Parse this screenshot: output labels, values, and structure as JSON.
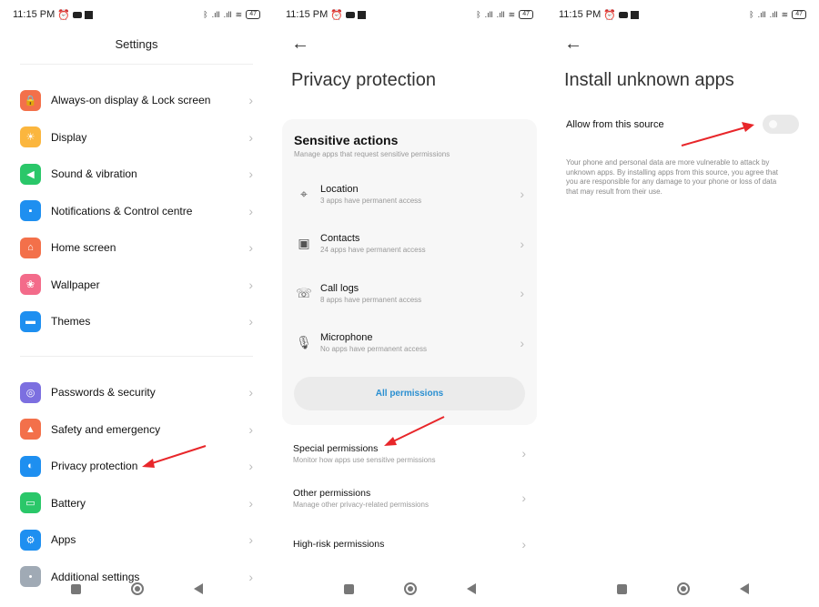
{
  "status_bar": {
    "time": "11:15 PM",
    "battery": "47"
  },
  "screen1": {
    "title": "Settings",
    "group1": [
      {
        "label": "Always-on display & Lock screen",
        "icon": "lock-icon",
        "color": "#f3704a",
        "glyph": "🔒"
      },
      {
        "label": "Display",
        "icon": "sun-icon",
        "color": "#fbb63e",
        "glyph": "☀"
      },
      {
        "label": "Sound & vibration",
        "icon": "speaker-icon",
        "color": "#2ac769",
        "glyph": "◀"
      },
      {
        "label": "Notifications & Control centre",
        "icon": "notification-icon",
        "color": "#1e8ff0",
        "glyph": "▪"
      },
      {
        "label": "Home screen",
        "icon": "home-icon",
        "color": "#f3704a",
        "glyph": "⌂"
      },
      {
        "label": "Wallpaper",
        "icon": "tulip-icon",
        "color": "#f36b8a",
        "glyph": "❀"
      },
      {
        "label": "Themes",
        "icon": "brush-icon",
        "color": "#1e8ff0",
        "glyph": "▬"
      }
    ],
    "group2": [
      {
        "label": "Passwords & security",
        "icon": "fingerprint-icon",
        "color": "#7c6fe0",
        "glyph": "◎"
      },
      {
        "label": "Safety and emergency",
        "icon": "siren-icon",
        "color": "#f3704a",
        "glyph": "▲"
      },
      {
        "label": "Privacy protection",
        "icon": "shield-icon",
        "color": "#1e8ff0",
        "glyph": "◐"
      },
      {
        "label": "Battery",
        "icon": "battery-icon",
        "color": "#2ac769",
        "glyph": "▭"
      },
      {
        "label": "Apps",
        "icon": "gear-icon",
        "color": "#1e8ff0",
        "glyph": "⚙"
      },
      {
        "label": "Additional settings",
        "icon": "more-icon",
        "color": "#a0aab5",
        "glyph": "•"
      }
    ]
  },
  "screen2": {
    "title": "Privacy protection",
    "card": {
      "title": "Sensitive actions",
      "subtitle": "Manage apps that request sensitive permissions",
      "items": [
        {
          "title": "Location",
          "sub": "3 apps have permanent access",
          "glyph": "⌖"
        },
        {
          "title": "Contacts",
          "sub": "24 apps have permanent access",
          "glyph": "▣"
        },
        {
          "title": "Call logs",
          "sub": "8 apps have permanent access",
          "glyph": "☏"
        },
        {
          "title": "Microphone",
          "sub": "No apps have permanent access",
          "glyph": "🎙"
        }
      ],
      "button": "All permissions"
    },
    "options": [
      {
        "title": "Special permissions",
        "sub": "Monitor how apps use sensitive permissions"
      },
      {
        "title": "Other permissions",
        "sub": "Manage other privacy-related permissions"
      },
      {
        "title": "High-risk permissions",
        "sub": ""
      }
    ]
  },
  "screen3": {
    "title": "Install unknown apps",
    "toggle_label": "Allow from this source",
    "toggle_on": false,
    "warning": "Your phone and personal data are more vulnerable to attack by unknown apps. By installing apps from this source, you agree that you are responsible for any damage to your phone or loss of data that may result from their use."
  }
}
